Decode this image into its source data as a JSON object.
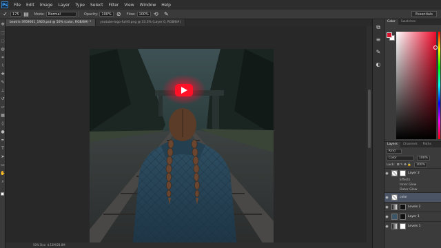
{
  "menu": {
    "logo": "Ps",
    "items": [
      "File",
      "Edit",
      "Image",
      "Layer",
      "Type",
      "Select",
      "Filter",
      "View",
      "Window",
      "Help"
    ]
  },
  "options": {
    "size_value": "175",
    "mode_label": "Mode:",
    "mode_value": "Normal",
    "opacity_label": "Opacity:",
    "opacity_value": "100%",
    "flow_label": "Flow:",
    "flow_value": "100%",
    "workspace": "Essentials"
  },
  "tabs": [
    {
      "label": "beatris-3959001_1920.psd @ 50% (color, RGB/8#) *",
      "active": true
    },
    {
      "label": "youtube-logo-full-B.png @ 33.3% (Layer 0, RGB/8#)",
      "active": false
    }
  ],
  "status": {
    "text": "50%    Doc: 4.12M/28.8M"
  },
  "color_panel": {
    "tabs": [
      "Color",
      "Swatches"
    ],
    "foreground": "#d8132d",
    "background": "#ffffff"
  },
  "layers_panel": {
    "tabs": [
      "Layers",
      "Channels",
      "Paths"
    ],
    "kind_label": "Kind",
    "blend_mode": "Color",
    "opacity_value": "100%",
    "lock_label": "Lock:",
    "fill_value": "100%",
    "layers": [
      {
        "name": "Layer 2",
        "thumb": "checker",
        "selected": false
      },
      {
        "name": "color",
        "thumb": "checker",
        "selected": true
      },
      {
        "name": "Levels 2",
        "thumb": "grad",
        "selected": false
      },
      {
        "name": "Layer 1",
        "thumb": "photo-t",
        "selected": false
      },
      {
        "name": "Levels 1",
        "thumb": "grad",
        "selected": false
      }
    ],
    "effects": [
      "Effects",
      "Inner Glow",
      "Outer Glow"
    ]
  }
}
